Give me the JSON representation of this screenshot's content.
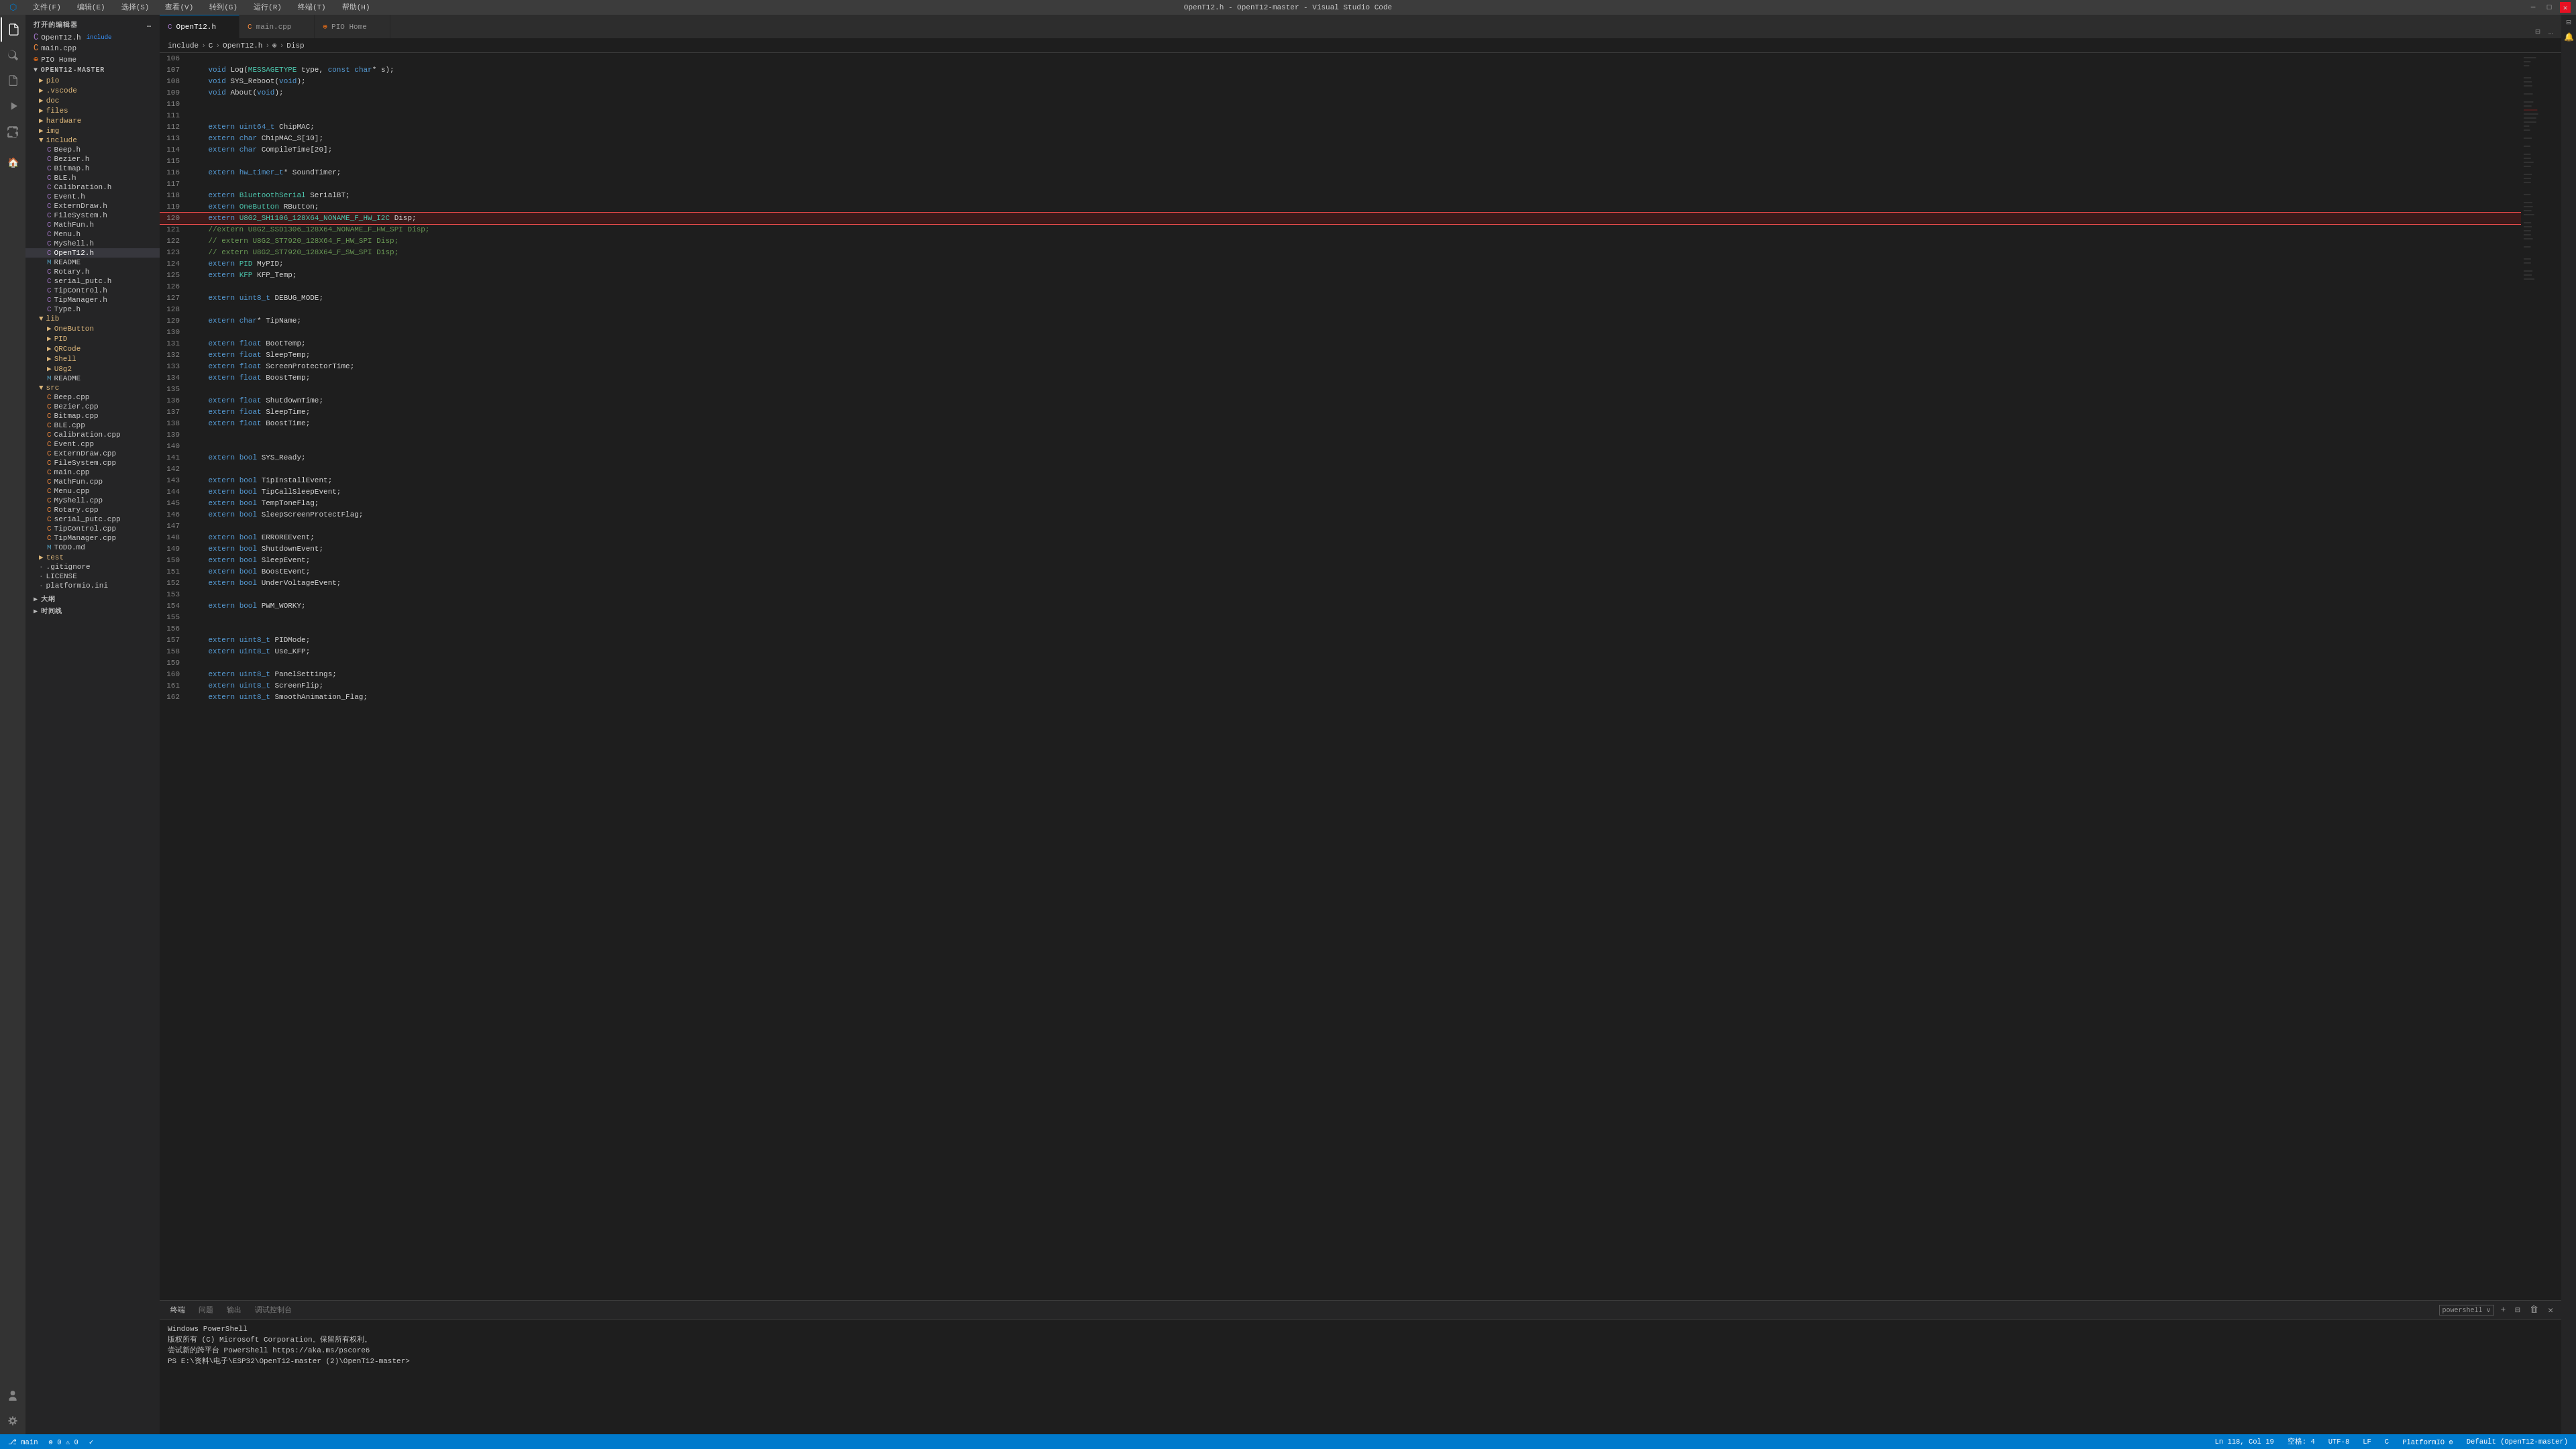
{
  "titlebar": {
    "title": "OpenT12.h - OpenT12-master - Visual Studio Code",
    "menu": [
      "文件(F)",
      "编辑(E)",
      "选择(S)",
      "查看(V)",
      "转到(G)",
      "运行(R)",
      "终端(T)",
      "帮助(H)"
    ],
    "controls": [
      "⊟",
      "❐",
      "✕"
    ]
  },
  "sidebar": {
    "header": "打开的编辑器",
    "explorer_header": "OPENТ12-MASTER",
    "open_editors": [
      {
        "name": "OpenT12.h",
        "type": "h",
        "badge": "include",
        "active": true
      },
      {
        "name": "main.cpp",
        "type": "cpp"
      }
    ],
    "pio_home": "PIO Home",
    "folders": [
      {
        "name": "pio",
        "type": "folder",
        "indent": 1
      },
      {
        "name": ".vscode",
        "type": "folder",
        "indent": 1
      },
      {
        "name": "doc",
        "type": "folder",
        "indent": 1
      },
      {
        "name": "files",
        "type": "folder",
        "indent": 1
      },
      {
        "name": "hardware",
        "type": "folder",
        "indent": 1
      },
      {
        "name": "img",
        "type": "folder",
        "indent": 1
      },
      {
        "name": "include",
        "type": "folder",
        "indent": 1,
        "expanded": true
      },
      {
        "name": "Beep.h",
        "type": "h",
        "indent": 2
      },
      {
        "name": "Bezier.h",
        "type": "h",
        "indent": 2
      },
      {
        "name": "Bitmap.h",
        "type": "h",
        "indent": 2
      },
      {
        "name": "BLE.h",
        "type": "h",
        "indent": 2
      },
      {
        "name": "Calibration.h",
        "type": "h",
        "indent": 2
      },
      {
        "name": "Event.h",
        "type": "h",
        "indent": 2
      },
      {
        "name": "ExternDraw.h",
        "type": "h",
        "indent": 2
      },
      {
        "name": "FileSystem.h",
        "type": "h",
        "indent": 2
      },
      {
        "name": "MathFun.h",
        "type": "h",
        "indent": 2
      },
      {
        "name": "Menu.h",
        "type": "h",
        "indent": 2
      },
      {
        "name": "MyShell.h",
        "type": "h",
        "indent": 2
      },
      {
        "name": "OpenT12.h",
        "type": "h",
        "indent": 2,
        "active": true
      },
      {
        "name": "README",
        "type": "md",
        "indent": 2
      },
      {
        "name": "Rotary.h",
        "type": "h",
        "indent": 2
      },
      {
        "name": "serial_putc.h",
        "type": "h",
        "indent": 2
      },
      {
        "name": "TipControl.h",
        "type": "h",
        "indent": 2
      },
      {
        "name": "TipManager.h",
        "type": "h",
        "indent": 2
      },
      {
        "name": "Type.h",
        "type": "h",
        "indent": 2
      },
      {
        "name": "lib",
        "type": "folder",
        "indent": 1,
        "expanded": true
      },
      {
        "name": "OneButton",
        "type": "folder",
        "indent": 2
      },
      {
        "name": "PID",
        "type": "folder",
        "indent": 2
      },
      {
        "name": "QRCode",
        "type": "folder",
        "indent": 2
      },
      {
        "name": "Shell",
        "type": "folder",
        "indent": 2
      },
      {
        "name": "U8g2",
        "type": "folder",
        "indent": 2
      },
      {
        "name": "README",
        "type": "md",
        "indent": 2
      },
      {
        "name": "src",
        "type": "folder",
        "indent": 1,
        "expanded": true
      },
      {
        "name": "Beep.cpp",
        "type": "cpp",
        "indent": 2
      },
      {
        "name": "Bezier.cpp",
        "type": "cpp",
        "indent": 2
      },
      {
        "name": "Bitmap.cpp",
        "type": "cpp",
        "indent": 2
      },
      {
        "name": "BLE.cpp",
        "type": "cpp",
        "indent": 2
      },
      {
        "name": "Calibration.cpp",
        "type": "cpp",
        "indent": 2
      },
      {
        "name": "Event.cpp",
        "type": "cpp",
        "indent": 2
      },
      {
        "name": "ExternDraw.cpp",
        "type": "cpp",
        "indent": 2
      },
      {
        "name": "FileSystem.cpp",
        "type": "cpp",
        "indent": 2
      },
      {
        "name": "main.cpp",
        "type": "cpp",
        "indent": 2
      },
      {
        "name": "MathFun.cpp",
        "type": "cpp",
        "indent": 2
      },
      {
        "name": "Menu.cpp",
        "type": "cpp",
        "indent": 2
      },
      {
        "name": "MyShell.cpp",
        "type": "cpp",
        "indent": 2
      },
      {
        "name": "Rotary.cpp",
        "type": "cpp",
        "indent": 2
      },
      {
        "name": "serial_putc.cpp",
        "type": "cpp",
        "indent": 2
      },
      {
        "name": "TipControl.cpp",
        "type": "cpp",
        "indent": 2
      },
      {
        "name": "TipManager.cpp",
        "type": "cpp",
        "indent": 2
      },
      {
        "name": "TODO.md",
        "type": "md",
        "indent": 2
      },
      {
        "name": "test",
        "type": "folder",
        "indent": 1
      },
      {
        "name": ".gitignore",
        "type": "file",
        "indent": 1
      },
      {
        "name": "LICENSE",
        "type": "file",
        "indent": 1
      },
      {
        "name": "platformio.ini",
        "type": "file",
        "indent": 1
      }
    ],
    "outline_header": "大纲",
    "timeline_header": "时间线"
  },
  "tabs": [
    {
      "name": "OpenT12.h",
      "type": "h",
      "active": true,
      "modified": false
    },
    {
      "name": "main.cpp",
      "type": "cpp",
      "active": false,
      "modified": false
    },
    {
      "name": "PIO Home",
      "type": "pio",
      "active": false,
      "modified": false
    }
  ],
  "breadcrumb": {
    "items": [
      "include",
      "C",
      "OpenT12.h",
      "⊕",
      "Disp"
    ]
  },
  "code": {
    "lines": [
      {
        "num": 106,
        "content": ""
      },
      {
        "num": 107,
        "content": "    void Log(MESSAGETYPE type, const char* s);"
      },
      {
        "num": 108,
        "content": "    void SYS_Reboot(void);"
      },
      {
        "num": 109,
        "content": "    void About(void);"
      },
      {
        "num": 110,
        "content": ""
      },
      {
        "num": 111,
        "content": ""
      },
      {
        "num": 112,
        "content": "    extern uint64_t ChipMAC;"
      },
      {
        "num": 113,
        "content": "    extern char ChipMAC_S[10];"
      },
      {
        "num": 114,
        "content": "    extern char CompileTime[20];"
      },
      {
        "num": 115,
        "content": ""
      },
      {
        "num": 116,
        "content": "    extern hw_timer_t* SoundTimer;"
      },
      {
        "num": 117,
        "content": ""
      },
      {
        "num": 118,
        "content": "    extern BluetoothSerial SerialBT;"
      },
      {
        "num": 119,
        "content": "    extern OneButton RButton;"
      },
      {
        "num": 120,
        "content": "    extern U8G2_SH1106_128X64_NONAME_F_HW_I2C Disp;",
        "highlight": true
      },
      {
        "num": 121,
        "content": "    //extern U8G2_SSD1306_128X64_NONAME_F_HW_SPI Disp;"
      },
      {
        "num": 122,
        "content": "    // extern U8G2_ST7920_128X64_F_HW_SPI Disp;"
      },
      {
        "num": 123,
        "content": "    // extern U8G2_ST7920_128X64_F_SW_SPI Disp;"
      },
      {
        "num": 124,
        "content": "    extern PID MyPID;"
      },
      {
        "num": 125,
        "content": "    extern KFP KFP_Temp;"
      },
      {
        "num": 126,
        "content": ""
      },
      {
        "num": 127,
        "content": "    extern uint8_t DEBUG_MODE;"
      },
      {
        "num": 128,
        "content": ""
      },
      {
        "num": 129,
        "content": "    extern char* TipName;"
      },
      {
        "num": 130,
        "content": ""
      },
      {
        "num": 131,
        "content": "    extern float BootTemp;"
      },
      {
        "num": 132,
        "content": "    extern float SleepTemp;"
      },
      {
        "num": 133,
        "content": "    extern float ScreenProtectorTime;"
      },
      {
        "num": 134,
        "content": "    extern float BoostTemp;"
      },
      {
        "num": 135,
        "content": ""
      },
      {
        "num": 136,
        "content": "    extern float ShutdownTime;"
      },
      {
        "num": 137,
        "content": "    extern float SleepTime;"
      },
      {
        "num": 138,
        "content": "    extern float BoostTime;"
      },
      {
        "num": 139,
        "content": ""
      },
      {
        "num": 140,
        "content": ""
      },
      {
        "num": 141,
        "content": "    extern bool SYS_Ready;"
      },
      {
        "num": 142,
        "content": ""
      },
      {
        "num": 143,
        "content": "    extern bool TipInstallEvent;"
      },
      {
        "num": 144,
        "content": "    extern bool TipCallSleepEvent;"
      },
      {
        "num": 145,
        "content": "    extern bool TempToneFlag;"
      },
      {
        "num": 146,
        "content": "    extern bool SleepScreenProtectFlag;"
      },
      {
        "num": 147,
        "content": ""
      },
      {
        "num": 148,
        "content": "    extern bool ERROREEvent;"
      },
      {
        "num": 149,
        "content": "    extern bool ShutdownEvent;"
      },
      {
        "num": 150,
        "content": "    extern bool SleepEvent;"
      },
      {
        "num": 151,
        "content": "    extern bool BoostEvent;"
      },
      {
        "num": 152,
        "content": "    extern bool UnderVoltageEvent;"
      },
      {
        "num": 153,
        "content": ""
      },
      {
        "num": 154,
        "content": "    extern bool PWM_WORKY;"
      },
      {
        "num": 155,
        "content": ""
      },
      {
        "num": 156,
        "content": ""
      },
      {
        "num": 157,
        "content": "    extern uint8_t PIDMode;"
      },
      {
        "num": 158,
        "content": "    extern uint8_t Use_KFP;"
      },
      {
        "num": 159,
        "content": ""
      },
      {
        "num": 160,
        "content": "    extern uint8_t PanelSettings;"
      },
      {
        "num": 161,
        "content": "    extern uint8_t ScreenFlip;"
      },
      {
        "num": 162,
        "content": "    extern uint8_t SmoothAnimation_Flag;"
      }
    ]
  },
  "terminal": {
    "tabs": [
      {
        "label": "powershell",
        "active": true
      },
      {
        "label": "+",
        "active": false
      }
    ],
    "output": [
      "Windows PowerShell",
      "版权所有 (C) Microsoft Corporation。保留所有权利。",
      "",
      "尝试新的跨平台 PowerShell https://aka.ms/pscore6",
      "",
      "PS E:\\资料\\电子\\ESP32\\OpenT12-master (2)\\OpenT12-master> "
    ]
  },
  "statusbar": {
    "left": [
      {
        "text": "⎇ main",
        "icon": "branch-icon"
      },
      {
        "text": "⊗ 0  ⚠ 0",
        "icon": "error-icon"
      },
      {
        "text": "✓",
        "icon": "check-icon"
      }
    ],
    "right": [
      {
        "text": "Ln 118, Col 19"
      },
      {
        "text": "空格: 4"
      },
      {
        "text": "UTF-8"
      },
      {
        "text": "LF"
      },
      {
        "text": "C"
      },
      {
        "text": "PlatformIO ⊕"
      },
      {
        "text": "Default (OpenT12-master)"
      }
    ]
  },
  "icons": {
    "explorer": "📁",
    "search": "🔍",
    "git": "⎇",
    "debug": "▷",
    "extensions": "⊞",
    "pio": "🏠",
    "settings": "⚙",
    "account": "👤",
    "arrow_right": "▶",
    "arrow_down": "▼",
    "close": "✕",
    "ellipsis": "…",
    "minimize": "─",
    "maximize": "□",
    "restore": "❐"
  }
}
